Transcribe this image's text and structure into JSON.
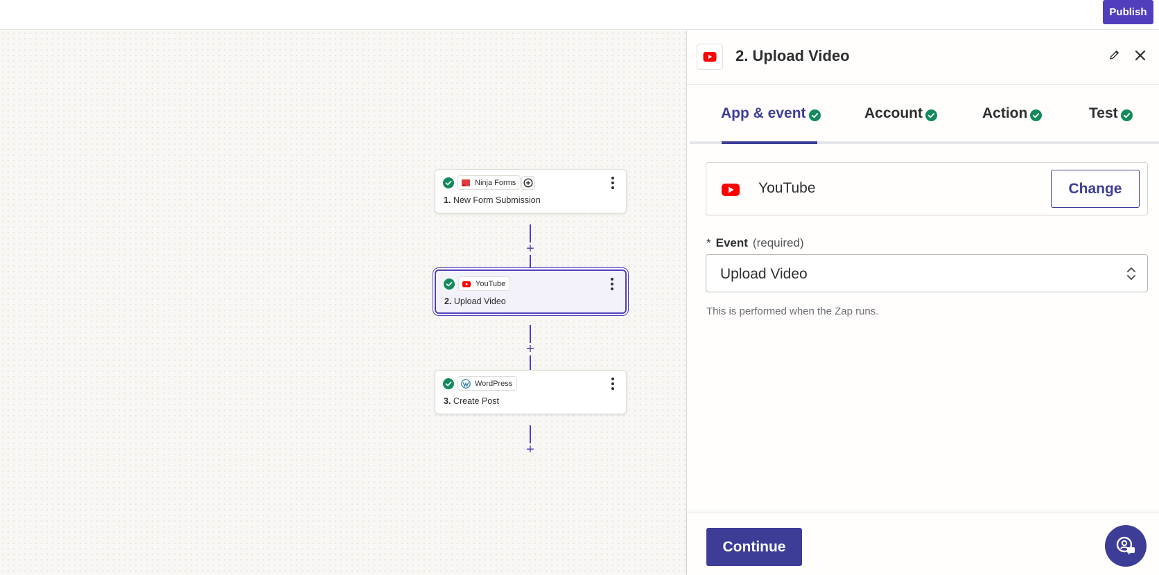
{
  "topbar": {
    "publish_label": "Publish"
  },
  "workflow": {
    "steps": [
      {
        "app": "Ninja Forms",
        "number": "1.",
        "title": "New Form Submission",
        "icon": "ninja-forms-icon",
        "status": "check-icon"
      },
      {
        "app": "YouTube",
        "number": "2.",
        "title": "Upload Video",
        "icon": "youtube-icon",
        "status": "check-icon"
      },
      {
        "app": "WordPress",
        "number": "3.",
        "title": "Create Post",
        "icon": "wordpress-icon",
        "status": "check-icon"
      }
    ],
    "add_step_symbol": "+"
  },
  "panel": {
    "title": "2. Upload Video",
    "tabs": [
      {
        "label": "App & event",
        "active": true
      },
      {
        "label": "Account",
        "active": false
      },
      {
        "label": "Action",
        "active": false
      },
      {
        "label": "Test",
        "active": false
      }
    ],
    "app": {
      "name": "YouTube",
      "change_label": "Change"
    },
    "event": {
      "required_marker": "*",
      "label": "Event",
      "required_text": "(required)",
      "value": "Upload Video",
      "helper": "This is performed when the Zap runs."
    },
    "continue_label": "Continue"
  },
  "colors": {
    "brand": "#503ebd",
    "accent": "#3d3d98",
    "success": "#138a5b",
    "youtube_red": "#ff0000"
  }
}
